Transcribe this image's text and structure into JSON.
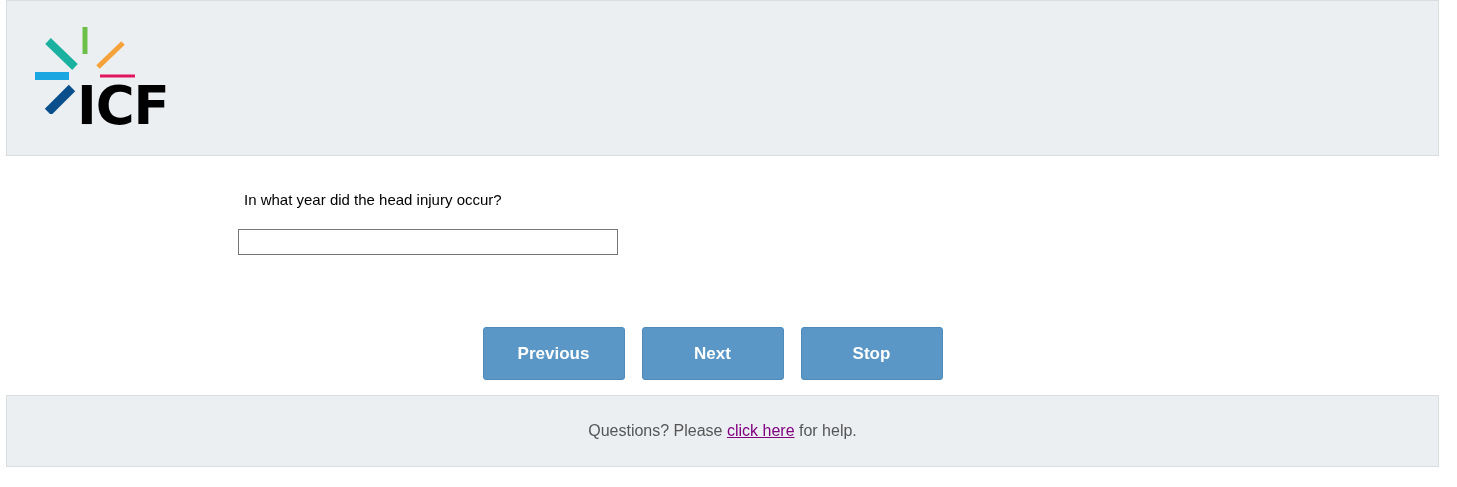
{
  "header": {
    "logo": {
      "text": "ICF"
    }
  },
  "question": {
    "label": "In what year did the head injury occur?"
  },
  "buttons": [
    {
      "label": "Previous"
    },
    {
      "label": "Next"
    },
    {
      "label": "Stop"
    }
  ],
  "footer": {
    "before": "Questions? Please",
    "link": "click here",
    "after": "for help."
  }
}
